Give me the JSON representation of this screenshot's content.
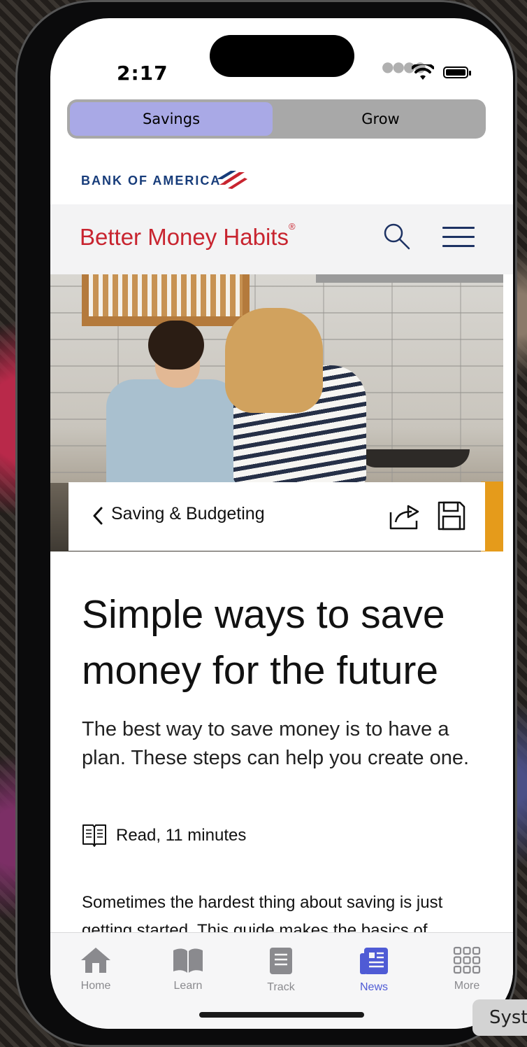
{
  "status": {
    "time": "2:17"
  },
  "segment": {
    "options": [
      "Savings",
      "Grow"
    ],
    "selected": "Savings"
  },
  "brand": {
    "bank_name": "BANK OF AMERICA",
    "site_title": "Better Money Habits",
    "registered_mark": "®"
  },
  "breadcrumb": {
    "label": "Saving & Budgeting"
  },
  "article": {
    "headline": "Simple ways to save money for the future",
    "dek": "The best way to save money is to have a plan. These steps can help you create one.",
    "read_time": "Read, 11 minutes",
    "body_start": "Sometimes the hardest thing about saving is just getting started. This guide makes the basics of"
  },
  "tabs": [
    {
      "label": "Home",
      "icon": "house-icon",
      "active": false
    },
    {
      "label": "Learn",
      "icon": "book-icon",
      "active": false
    },
    {
      "label": "Track",
      "icon": "notebook-icon",
      "active": false
    },
    {
      "label": "News",
      "icon": "newspaper-icon",
      "active": true
    },
    {
      "label": "More",
      "icon": "grid-icon",
      "active": false
    }
  ],
  "overlay": {
    "system_pill_text": "Syst"
  },
  "colors": {
    "brand_red": "#c8242f",
    "brand_navy": "#173c7a",
    "segment_selected": "#a9a9e6",
    "tab_active": "#4f5bd5"
  }
}
